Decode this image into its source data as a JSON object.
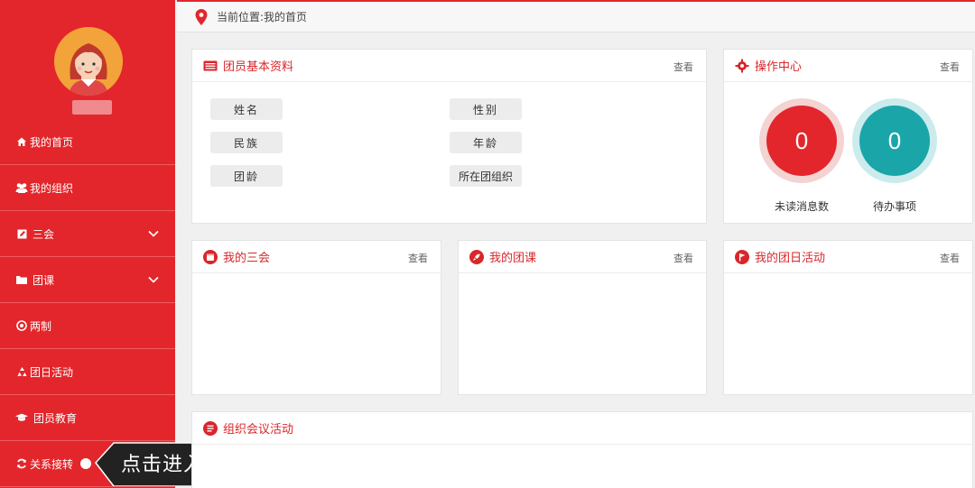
{
  "breadcrumb": {
    "text": "当前位置:我的首页"
  },
  "sidebar": {
    "items": [
      {
        "label": "我的首页",
        "icon": "home-icon"
      },
      {
        "label": "我的组织",
        "icon": "users-icon"
      },
      {
        "label": "三会",
        "icon": "edit-icon",
        "has_submenu": true
      },
      {
        "label": "团课",
        "icon": "folder-icon",
        "has_submenu": true
      },
      {
        "label": "两制",
        "icon": "target-icon"
      },
      {
        "label": "团日活动",
        "icon": "recycle-icon"
      },
      {
        "label": "团员教育",
        "icon": "graduation-cap-icon"
      },
      {
        "label": "关系接转",
        "icon": "refresh-icon"
      }
    ]
  },
  "callout": {
    "text": "点击进入"
  },
  "profile_panel": {
    "title": "团员基本资料",
    "more": "查看",
    "fields": [
      "姓名",
      "性别",
      "民族",
      "年龄",
      "团龄",
      "所在团组织"
    ]
  },
  "ops_panel": {
    "title": "操作中心",
    "more": "查看",
    "unread": {
      "value": "0",
      "label": "未读消息数",
      "color": "#e3262b"
    },
    "todo": {
      "value": "0",
      "label": "待办事项",
      "color": "#1aa5a9"
    }
  },
  "meetings_panel": {
    "title": "我的三会",
    "more": "查看"
  },
  "lessons_panel": {
    "title": "我的团课",
    "more": "查看"
  },
  "activity_panel": {
    "title": "我的团日活动",
    "more": "查看"
  },
  "org_meeting_panel": {
    "title": "组织会议活动"
  },
  "colors": {
    "brand": "#e3262b",
    "teal": "#1aa5a9"
  }
}
